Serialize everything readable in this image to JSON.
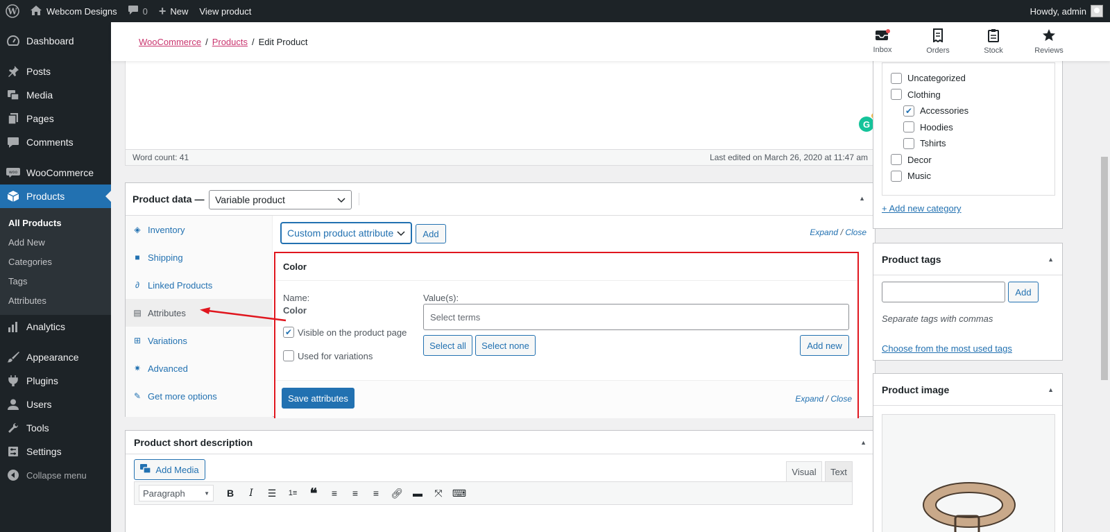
{
  "adminbar": {
    "site_name": "Webcom Designs",
    "comments_count": "0",
    "new_label": "New",
    "view_product": "View product",
    "howdy": "Howdy, admin"
  },
  "sidebar": {
    "items": [
      {
        "label": "Dashboard"
      },
      {
        "label": "Posts"
      },
      {
        "label": "Media"
      },
      {
        "label": "Pages"
      },
      {
        "label": "Comments"
      },
      {
        "label": "WooCommerce"
      },
      {
        "label": "Products"
      },
      {
        "label": "Analytics"
      },
      {
        "label": "Appearance"
      },
      {
        "label": "Plugins"
      },
      {
        "label": "Users"
      },
      {
        "label": "Tools"
      },
      {
        "label": "Settings"
      },
      {
        "label": "Collapse menu"
      }
    ],
    "submenu": [
      "All Products",
      "Add New",
      "Categories",
      "Tags",
      "Attributes"
    ]
  },
  "header": {
    "breadcrumb": [
      "WooCommerce",
      "Products",
      "Edit Product"
    ],
    "actions": [
      "Inbox",
      "Orders",
      "Stock",
      "Reviews"
    ]
  },
  "editor": {
    "word_count": "Word count: 41",
    "last_edited": "Last edited on March 26, 2020 at 11:47 am"
  },
  "product_data": {
    "title": "Product data —",
    "type": "Variable product",
    "tabs": [
      "Inventory",
      "Shipping",
      "Linked Products",
      "Attributes",
      "Variations",
      "Advanced",
      "Get more options"
    ],
    "attribute_select": "Custom product attribute",
    "add_button": "Add",
    "expand": "Expand",
    "close": "Close",
    "attribute": {
      "name": "Color",
      "name_label": "Name:",
      "values_label": "Value(s):",
      "values_placeholder": "Select terms",
      "visible_label": "Visible on the product page",
      "variations_label": "Used for variations",
      "select_all": "Select all",
      "select_none": "Select none",
      "add_new": "Add new"
    },
    "save_attributes": "Save attributes"
  },
  "categories": {
    "items": [
      "Uncategorized",
      "Clothing",
      "Accessories",
      "Hoodies",
      "Tshirts",
      "Decor",
      "Music"
    ],
    "add_new": "+ Add new category"
  },
  "tags": {
    "title": "Product tags",
    "add": "Add",
    "hint": "Separate tags with commas",
    "choose": "Choose from the most used tags"
  },
  "product_image": {
    "title": "Product image"
  },
  "short_description": {
    "title": "Product short description",
    "add_media": "Add Media",
    "tab_visual": "Visual",
    "tab_text": "Text",
    "format": "Paragraph"
  },
  "colors": {
    "accent": "#2271b1",
    "highlight": "#e0161e",
    "woo": "#c9356e"
  }
}
